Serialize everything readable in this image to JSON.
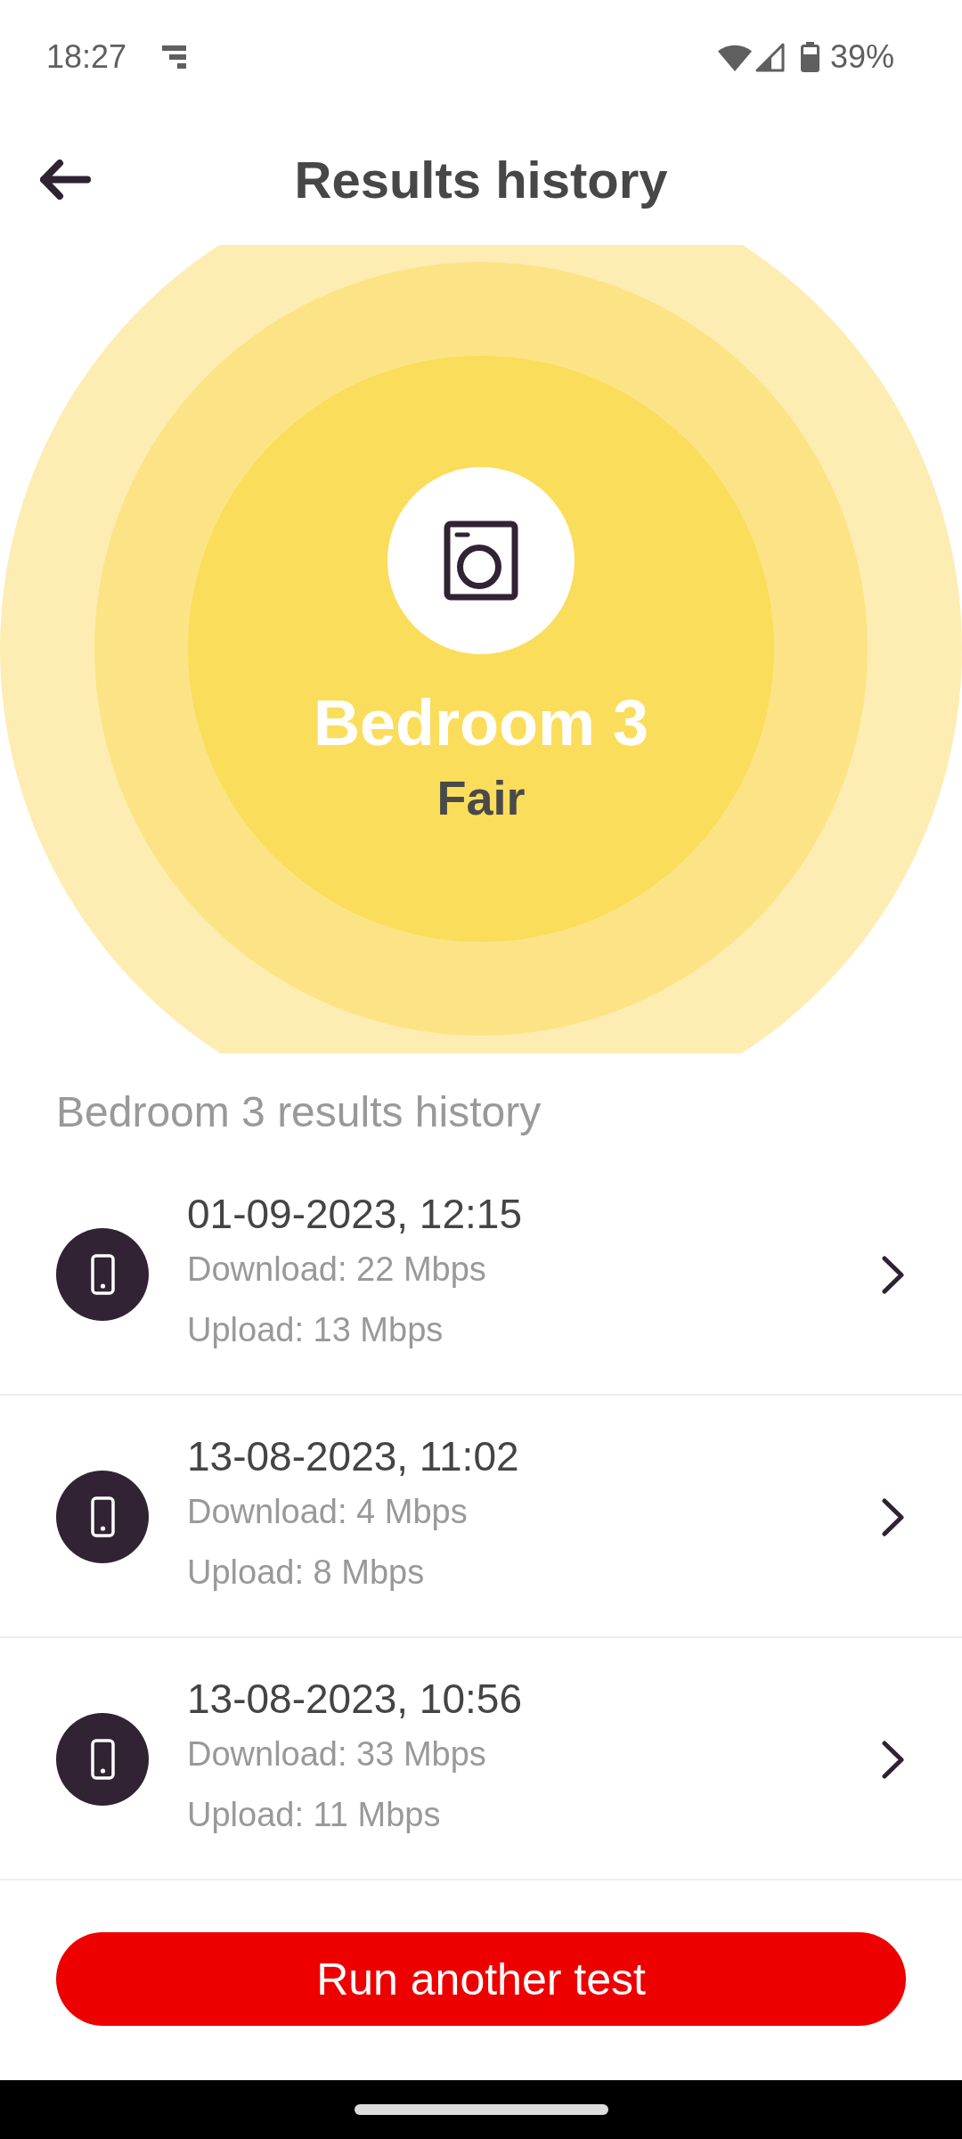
{
  "status_bar": {
    "time": "18:27",
    "battery": "39%"
  },
  "header": {
    "title": "Results history"
  },
  "room": {
    "name": "Bedroom 3",
    "rating": "Fair"
  },
  "history": {
    "title": "Bedroom 3 results history",
    "results": [
      {
        "date": "01-09-2023, 12:15",
        "download": "Download: 22 Mbps",
        "upload": "Upload: 13 Mbps"
      },
      {
        "date": "13-08-2023, 11:02",
        "download": "Download: 4 Mbps",
        "upload": "Upload: 8 Mbps"
      },
      {
        "date": "13-08-2023, 10:56",
        "download": "Download: 33 Mbps",
        "upload": "Upload: 11 Mbps"
      }
    ]
  },
  "button": {
    "label": "Run another test"
  }
}
